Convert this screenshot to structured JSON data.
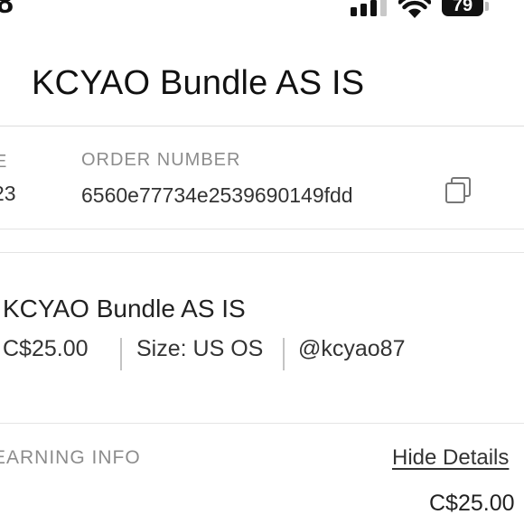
{
  "status_bar": {
    "time": "8",
    "battery": "79"
  },
  "header": {
    "title": "KCYAO Bundle AS IS"
  },
  "order_info": {
    "date_label_partial": "E",
    "date_value_partial": "23",
    "order_number_label": "ORDER NUMBER",
    "order_number": "6560e77734e2539690149fdd"
  },
  "item": {
    "title": "KCYAO Bundle AS IS",
    "price": "C$25.00",
    "size": "Size: US OS",
    "seller": "@kcyao87"
  },
  "earning": {
    "label": "EARNING INFO",
    "hide_details": "Hide Details",
    "amount": "C$25.00"
  },
  "icons": {
    "copy": "copy-icon",
    "signal": "cellular-signal-icon",
    "wifi": "wifi-icon",
    "battery": "battery-icon"
  }
}
